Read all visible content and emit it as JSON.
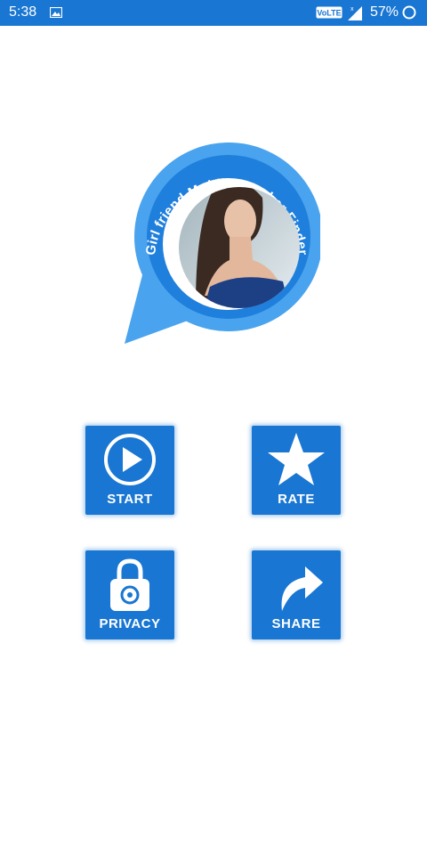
{
  "status_bar": {
    "time": "5:38",
    "volte": "VoLTE",
    "battery": "57%",
    "image_icon": "image-notification-icon",
    "signal_icon": "cell-signal-icon",
    "battery_icon": "battery-ring-icon"
  },
  "logo": {
    "title_text": "Girl friend Mobile Number Finder",
    "bubble_color": "#2f8de4",
    "ring_color": "#1976d2"
  },
  "menu": {
    "start_label": "START",
    "rate_label": "RATE",
    "privacy_label": "PRIVACY",
    "share_label": "SHARE",
    "start_icon": "play-icon",
    "rate_icon": "star-icon",
    "privacy_icon": "lock-icon",
    "share_icon": "share-arrow-icon",
    "tile_color": "#1976d2"
  }
}
